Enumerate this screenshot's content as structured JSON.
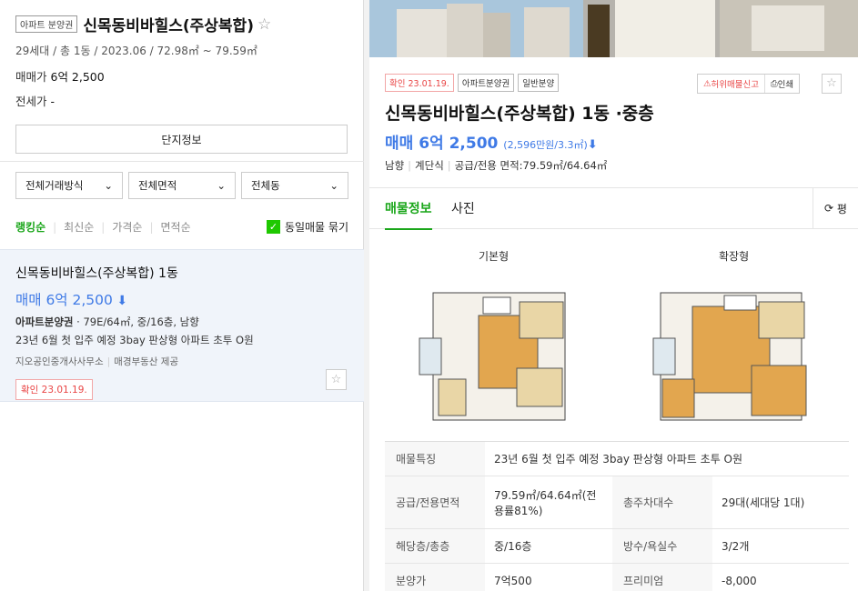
{
  "complex": {
    "tag": "아파트 분양권",
    "name": "신목동비바힐스(주상복합)",
    "meta": "29세대 / 총 1동 / 2023.06 / 72.98㎡ ~ 79.59㎡",
    "sale_label": "매매가",
    "sale_value": "6억 2,500",
    "jeonse_label": "전세가",
    "jeonse_value": "-",
    "info_button": "단지정보"
  },
  "filters": [
    "전체거래방식",
    "전체면적",
    "전체동"
  ],
  "sorts": [
    "랭킹순",
    "최신순",
    "가격순",
    "면적순"
  ],
  "same_listing": "동일매물 묶기",
  "listing": {
    "title": "신목동비바힐스(주상복합) 1동",
    "price": "매매 6억 2,500",
    "type": "아파트분양권",
    "spec": " · 79E/64㎡, 중/16층, 남향",
    "desc": "23년 6월 첫 입주 예정 3bay 판상형 아파트 초투 O원",
    "agent": "지오공인중개사사무소",
    "provider": "매경부동산 제공",
    "confirmed": "확인 23.01.19."
  },
  "detail": {
    "tags": [
      "확인 23.01.19.",
      "아파트분양권",
      "일반분양"
    ],
    "report": "허위매물신고",
    "print": "인쇄",
    "title": "신목동비바힐스(주상복합) 1동 ·중층",
    "price": "매매 6억 2,500",
    "unit_price": "(2,596만원/3.3㎡)",
    "direction": "남향",
    "stairs": "계단식",
    "area": "공급/전용 면적:79.59㎡/64.64㎡",
    "tabs": [
      "매물정보",
      "사진"
    ],
    "pyeong": "평",
    "plan_basic": "기본형",
    "plan_ext": "확장형",
    "table": {
      "feature_label": "매물특징",
      "feature_value": "23년 6월 첫 입주 예정 3bay 판상형 아파트 초투 O원",
      "area_label": "공급/전용면적",
      "area_value": "79.59㎡/64.64㎡(전용률81%)",
      "households_label": "총주차대수",
      "households_value": "29대(세대당 1대)",
      "floor_label": "해당층/총층",
      "floor_value": "중/16층",
      "rooms_label": "방수/욕실수",
      "rooms_value": "3/2개",
      "presale_label": "분양가",
      "presale_value": "7억500",
      "premium_label": "프리미엄",
      "premium_value": "-8,000"
    }
  },
  "colors": {
    "accent_green": "#1aa61a",
    "price_blue": "#3f7ae6",
    "confirm_red": "#e94545"
  }
}
